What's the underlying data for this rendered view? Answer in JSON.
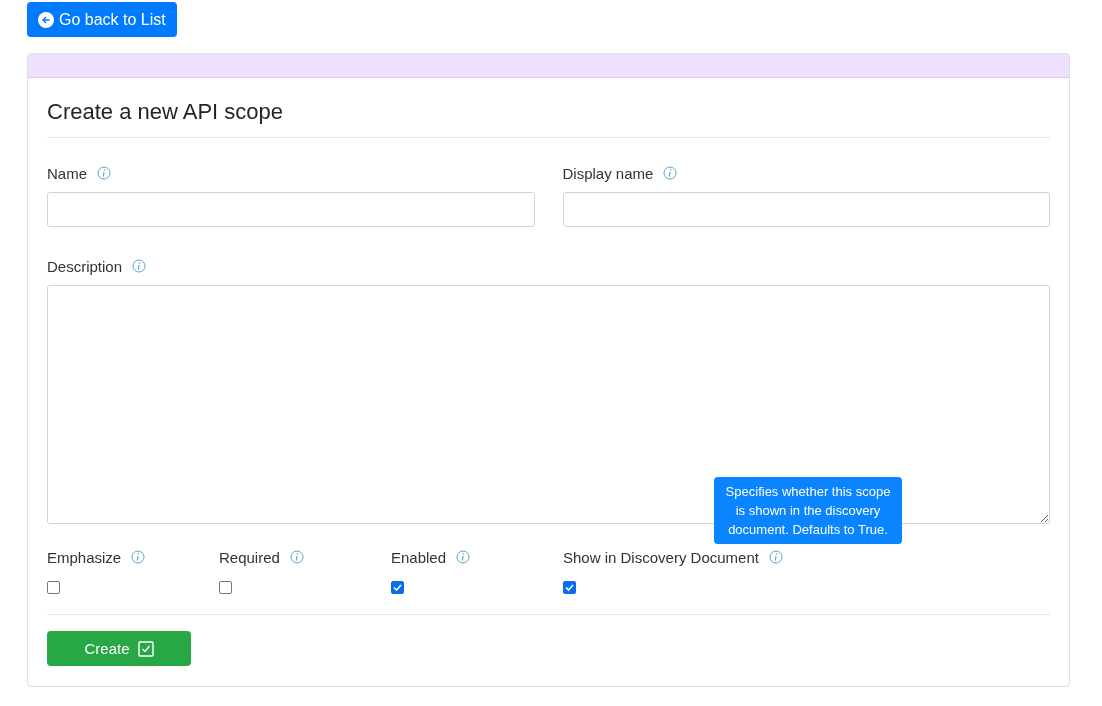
{
  "back_button": {
    "label": "Go back to List"
  },
  "form": {
    "title": "Create a new API scope",
    "text_fields": [
      {
        "label": "Name"
      },
      {
        "label": "Display name"
      }
    ],
    "description": {
      "label": "Description"
    },
    "checkboxes": [
      {
        "label": "Emphasize",
        "checked": false
      },
      {
        "label": "Required",
        "checked": false
      },
      {
        "label": "Enabled",
        "checked": true
      },
      {
        "label": "Show in Discovery Document",
        "checked": true,
        "tooltip": "Specifies whether this scope is shown in the discovery document. Defaults to True."
      }
    ],
    "submit_button": {
      "label": "Create"
    }
  }
}
